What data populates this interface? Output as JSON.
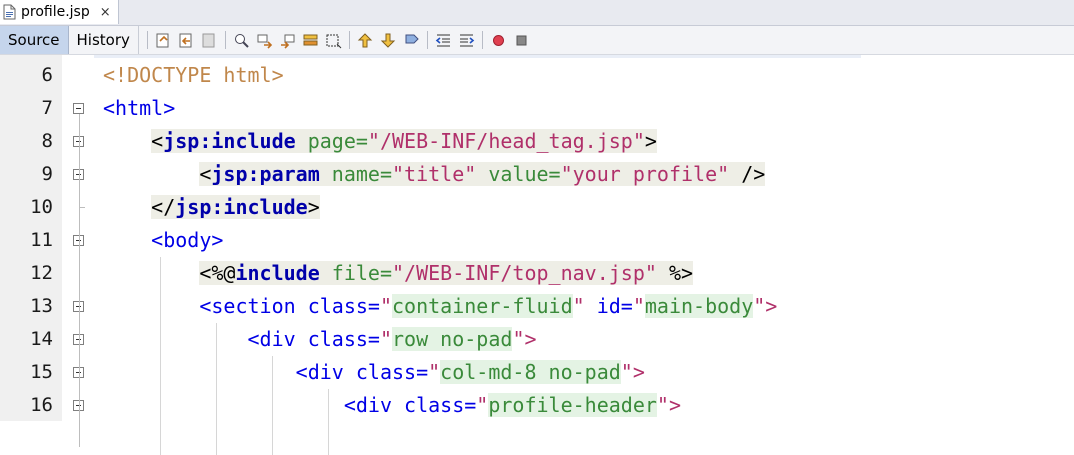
{
  "file_tab": {
    "label": "profile.jsp",
    "close_glyph": "×"
  },
  "toolbar": {
    "source_label": "Source",
    "history_label": "History",
    "icons": [
      "last-edit-icon",
      "back-icon",
      "forward-icon",
      "find-selection-icon",
      "find-previous-icon",
      "find-next-icon",
      "toggle-highlight-icon",
      "toggle-rect-selection-icon",
      "prev-bookmark-icon",
      "next-bookmark-icon",
      "toggle-bookmark-icon",
      "shift-left-icon",
      "shift-right-icon",
      "record-macro-icon",
      "stop-macro-icon"
    ]
  },
  "lines": [
    {
      "num": "6",
      "tokens": [
        {
          "t": "<!DOCTYPE html>",
          "c": "doctype"
        }
      ]
    },
    {
      "num": "7",
      "tokens": [
        {
          "t": "<html>",
          "c": "tag"
        }
      ]
    },
    {
      "num": "8",
      "tokens": [
        {
          "t": "    ",
          "c": "plain"
        },
        {
          "t": "<",
          "c": "plain jspbg"
        },
        {
          "t": "jsp:include",
          "c": "jsp jspbg"
        },
        {
          "t": " page=",
          "c": "attr jspbg"
        },
        {
          "t": "\"/WEB-INF/head_tag.jsp\"",
          "c": "val jspbg"
        },
        {
          "t": ">",
          "c": "plain jspbg"
        }
      ]
    },
    {
      "num": "9",
      "tokens": [
        {
          "t": "        ",
          "c": "plain"
        },
        {
          "t": "<",
          "c": "plain jspbg"
        },
        {
          "t": "jsp:param",
          "c": "jsp jspbg"
        },
        {
          "t": " name=",
          "c": "attr jspbg"
        },
        {
          "t": "\"title\"",
          "c": "val jspbg"
        },
        {
          "t": " value=",
          "c": "attr jspbg"
        },
        {
          "t": "\"your profile\"",
          "c": "val jspbg"
        },
        {
          "t": " />",
          "c": "plain jspbg"
        }
      ]
    },
    {
      "num": "10",
      "tokens": [
        {
          "t": "    ",
          "c": "plain"
        },
        {
          "t": "</",
          "c": "plain jspbg"
        },
        {
          "t": "jsp:include",
          "c": "jsp jspbg"
        },
        {
          "t": ">",
          "c": "plain jspbg"
        }
      ]
    },
    {
      "num": "11",
      "tokens": [
        {
          "t": "    ",
          "c": "plain"
        },
        {
          "t": "<body>",
          "c": "tag"
        }
      ]
    },
    {
      "num": "12",
      "tokens": [
        {
          "t": "        ",
          "c": "plain"
        },
        {
          "t": "<%@",
          "c": "plain jspbg"
        },
        {
          "t": "include",
          "c": "jsp jspbg"
        },
        {
          "t": " file=",
          "c": "attr jspbg"
        },
        {
          "t": "\"/WEB-INF/top_nav.jsp\"",
          "c": "val jspbg"
        },
        {
          "t": " %>",
          "c": "plain jspbg"
        }
      ]
    },
    {
      "num": "13",
      "tokens": [
        {
          "t": "        ",
          "c": "plain"
        },
        {
          "t": "<section ",
          "c": "tag"
        },
        {
          "t": "class=",
          "c": "tag"
        },
        {
          "t": "\"",
          "c": "val"
        },
        {
          "t": "container-fluid",
          "c": "attr valbg"
        },
        {
          "t": "\"",
          "c": "val"
        },
        {
          "t": " id=",
          "c": "tag"
        },
        {
          "t": "\"",
          "c": "val"
        },
        {
          "t": "main-body",
          "c": "attr valbg"
        },
        {
          "t": "\">",
          "c": "val"
        }
      ]
    },
    {
      "num": "14",
      "tokens": [
        {
          "t": "            ",
          "c": "plain"
        },
        {
          "t": "<div ",
          "c": "tag"
        },
        {
          "t": "class=",
          "c": "tag"
        },
        {
          "t": "\"",
          "c": "val"
        },
        {
          "t": "row no-pad",
          "c": "attr valbg"
        },
        {
          "t": "\">",
          "c": "val"
        }
      ]
    },
    {
      "num": "15",
      "tokens": [
        {
          "t": "                ",
          "c": "plain"
        },
        {
          "t": "<div ",
          "c": "tag"
        },
        {
          "t": "class=",
          "c": "tag"
        },
        {
          "t": "\"",
          "c": "val"
        },
        {
          "t": "col-md-8 no-pad",
          "c": "attr valbg"
        },
        {
          "t": "\">",
          "c": "val"
        }
      ]
    },
    {
      "num": "16",
      "tokens": [
        {
          "t": "                    ",
          "c": "plain"
        },
        {
          "t": "<div ",
          "c": "tag"
        },
        {
          "t": "class=",
          "c": "tag"
        },
        {
          "t": "\"",
          "c": "val"
        },
        {
          "t": "profile-header",
          "c": "attr valbg"
        },
        {
          "t": "\">",
          "c": "val"
        }
      ]
    }
  ],
  "folds": [
    "7",
    "8",
    "9",
    "11",
    "13",
    "14",
    "15",
    "16"
  ]
}
